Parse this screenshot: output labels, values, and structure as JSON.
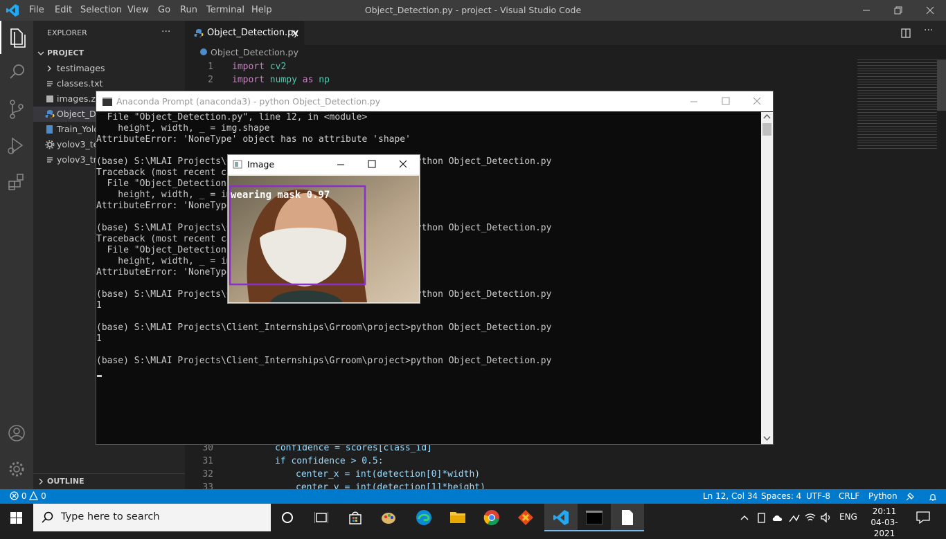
{
  "titlebar": {
    "menus": [
      "File",
      "Edit",
      "Selection",
      "View",
      "Go",
      "Run",
      "Terminal",
      "Help"
    ],
    "title": "Object_Detection.py - project - Visual Studio Code"
  },
  "sidebar": {
    "header": "EXPLORER",
    "more": "···",
    "project": "PROJECT",
    "items": [
      {
        "label": "testimages",
        "icon": "chevron-right-icon"
      },
      {
        "label": "classes.txt",
        "icon": "text-file-icon"
      },
      {
        "label": "images.zip",
        "icon": "zip-file-icon"
      },
      {
        "label": "Object_De",
        "icon": "python-file-icon"
      },
      {
        "label": "Train_Yolo",
        "icon": "notebook-file-icon"
      },
      {
        "label": "yolov3_te",
        "icon": "gear-file-icon"
      },
      {
        "label": "yolov3_tra",
        "icon": "text-file-icon"
      }
    ],
    "outline": "OUTLINE"
  },
  "editor": {
    "tab_label": "Object_Detection.py",
    "breadcrumb": "Object_Detection.py",
    "top_lines": [
      {
        "num": "1",
        "kw": "import",
        "rest": " cv2"
      },
      {
        "num": "2",
        "kw": "import",
        "rest": " numpy ",
        "kw2": "as",
        "rest2": " np"
      }
    ],
    "bottom_lines": [
      {
        "num": "30",
        "text": "confidence = scores[class_id]"
      },
      {
        "num": "31",
        "text": "if confidence > 0.5:"
      },
      {
        "num": "32",
        "text": "center_x = int(detection[0]*width)"
      },
      {
        "num": "33",
        "text": "center_y = int(detection[1]*height)"
      }
    ]
  },
  "anaconda": {
    "title": "Anaconda Prompt (anaconda3) - python  Object_Detection.py",
    "lines": [
      "  File \"Object_Detection.py\", line 12, in <module>",
      "    height, width, _ = img.shape",
      "AttributeError: 'NoneType' object has no attribute 'shape'",
      "",
      "(base) S:\\MLAI Projects\\Client_Internships\\Grroom\\project>python Object_Detection.py",
      "Traceback (most recent call last):",
      "  File \"Object_Detection.py\", line 12, in <module>",
      "    height, width, _ = img.shape",
      "AttributeError: 'NoneType' object has no attribute 'shape'",
      "",
      "(base) S:\\MLAI Projects\\Client_Internships\\Grroom\\project>python Object_Detection.py",
      "Traceback (most recent call last):",
      "  File \"Object_Detection.py\", line 12, in <module>",
      "    height, width, _ = img.shape",
      "AttributeError: 'NoneType' object has no attribute 'shape'",
      "",
      "(base) S:\\MLAI Projects\\Client_Internships\\Grroom\\project>python Object_Detection.py",
      "1",
      "",
      "(base) S:\\MLAI Projects\\Client_Internships\\Grroom\\project>python Object_Detection.py",
      "1",
      "",
      "(base) S:\\MLAI Projects\\Client_Internships\\Grroom\\project>python Object_Detection.py"
    ]
  },
  "image_window": {
    "title": "Image",
    "detection_label": "wearing mask 0.97",
    "box_color": "#8b2fc9"
  },
  "statusbar": {
    "errors": "0",
    "warnings": "0",
    "position": "Ln 12, Col 34",
    "spaces": "Spaces: 4",
    "encoding": "UTF-8",
    "eol": "CRLF",
    "language": "Python"
  },
  "taskbar": {
    "search_placeholder": "Type here to search",
    "lang": "ENG",
    "time": "20:11",
    "date": "04-03-2021"
  },
  "colors": {
    "accent": "#007acc",
    "keyword": "#c586c0",
    "func": "#4ec9b0",
    "number": "#b5cea8"
  }
}
